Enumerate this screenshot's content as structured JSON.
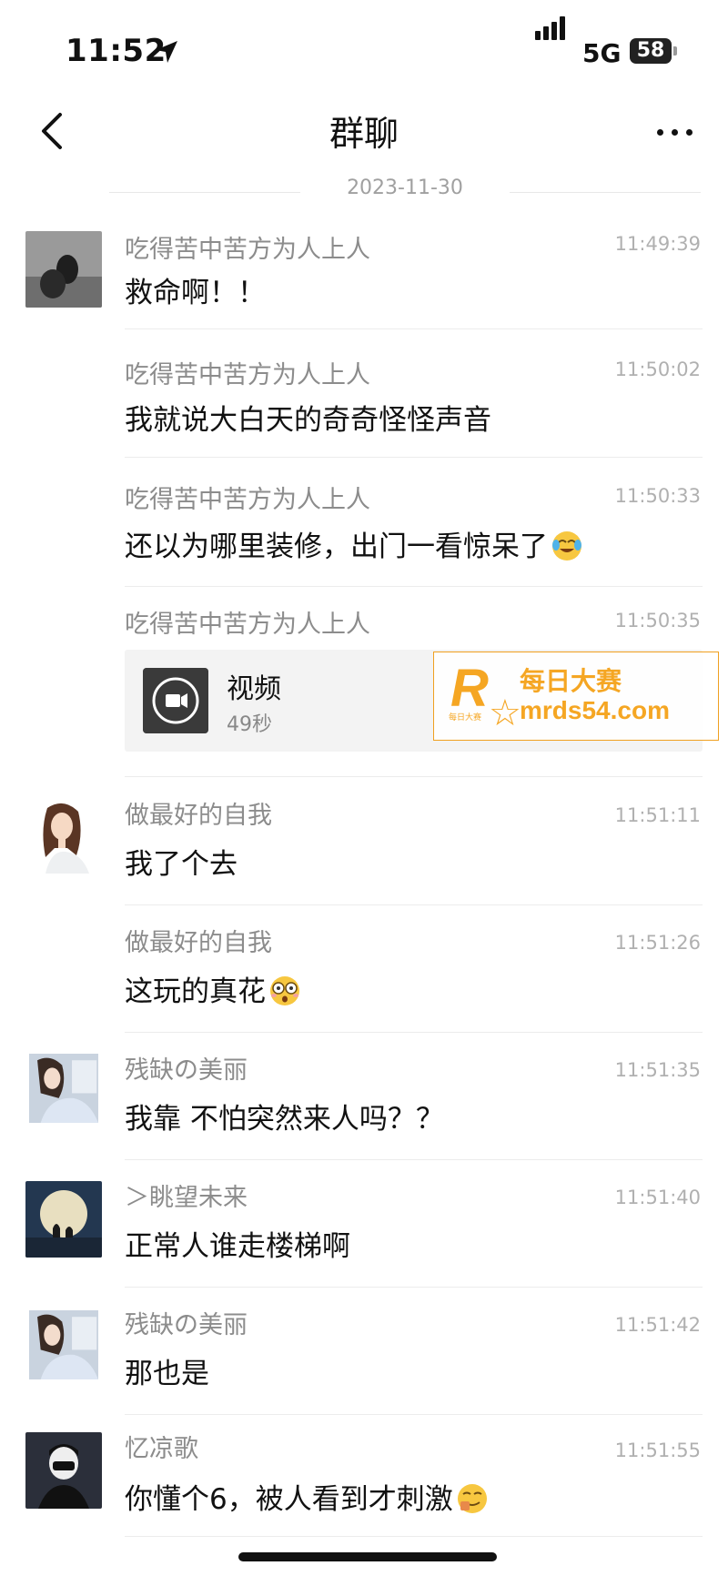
{
  "status": {
    "time": "11:52",
    "network": "5G",
    "battery": "58"
  },
  "nav": {
    "title": "群聊"
  },
  "date_separator": "2023-11-30",
  "messages": [
    {
      "sender": "吃得苦中苦方为人上人",
      "time": "11:49:39",
      "text": "救命啊！！"
    },
    {
      "sender": "吃得苦中苦方为人上人",
      "time": "11:50:02",
      "text": "我就说大白天的奇奇怪怪声音"
    },
    {
      "sender": "吃得苦中苦方为人上人",
      "time": "11:50:33",
      "text": "还以为哪里装修，出门一看惊呆了"
    },
    {
      "sender": "吃得苦中苦方为人上人",
      "time": "11:50:35",
      "video_title": "视频",
      "video_duration": "49秒"
    },
    {
      "sender": "做最好的自我",
      "time": "11:51:11",
      "text": "我了个去"
    },
    {
      "sender": "做最好的自我",
      "time": "11:51:26",
      "text": "这玩的真花"
    },
    {
      "sender": "残缺の美丽",
      "time": "11:51:35",
      "text": "我靠 不怕突然来人吗？？"
    },
    {
      "sender": "＞眺望未来",
      "time": "11:51:40",
      "text": "正常人谁走楼梯啊"
    },
    {
      "sender": "残缺の美丽",
      "time": "11:51:42",
      "text": "那也是"
    },
    {
      "sender": "忆凉歌",
      "time": "11:51:55",
      "text": "你懂个6，被人看到才刺激"
    }
  ],
  "watermark": {
    "brand_cn": "每日大赛",
    "url": "mrds54.com",
    "small": "每日大赛",
    "letter": "R"
  },
  "icons": {
    "location": "location-arrow-icon",
    "signal": "signal-bars-icon",
    "back": "chevron-left-icon",
    "more": "more-dots-icon",
    "video": "video-camera-icon"
  },
  "colors": {
    "accent_watermark": "#f5a623",
    "meta_text": "#8c8c8c",
    "time_text": "#b0b0b0"
  }
}
